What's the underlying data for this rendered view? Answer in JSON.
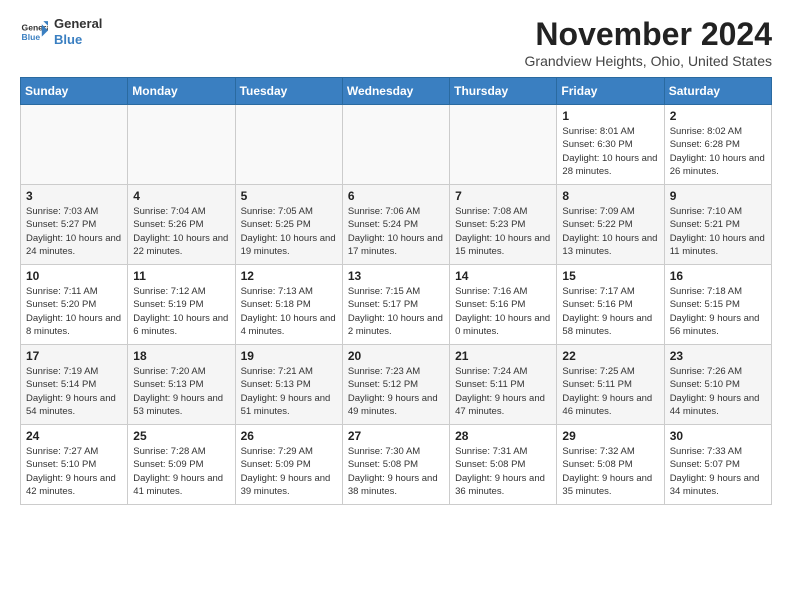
{
  "header": {
    "logo_line1": "General",
    "logo_line2": "Blue",
    "month": "November 2024",
    "location": "Grandview Heights, Ohio, United States"
  },
  "days_of_week": [
    "Sunday",
    "Monday",
    "Tuesday",
    "Wednesday",
    "Thursday",
    "Friday",
    "Saturday"
  ],
  "weeks": [
    [
      {
        "day": "",
        "info": ""
      },
      {
        "day": "",
        "info": ""
      },
      {
        "day": "",
        "info": ""
      },
      {
        "day": "",
        "info": ""
      },
      {
        "day": "",
        "info": ""
      },
      {
        "day": "1",
        "info": "Sunrise: 8:01 AM\nSunset: 6:30 PM\nDaylight: 10 hours and 28 minutes."
      },
      {
        "day": "2",
        "info": "Sunrise: 8:02 AM\nSunset: 6:28 PM\nDaylight: 10 hours and 26 minutes."
      }
    ],
    [
      {
        "day": "3",
        "info": "Sunrise: 7:03 AM\nSunset: 5:27 PM\nDaylight: 10 hours and 24 minutes."
      },
      {
        "day": "4",
        "info": "Sunrise: 7:04 AM\nSunset: 5:26 PM\nDaylight: 10 hours and 22 minutes."
      },
      {
        "day": "5",
        "info": "Sunrise: 7:05 AM\nSunset: 5:25 PM\nDaylight: 10 hours and 19 minutes."
      },
      {
        "day": "6",
        "info": "Sunrise: 7:06 AM\nSunset: 5:24 PM\nDaylight: 10 hours and 17 minutes."
      },
      {
        "day": "7",
        "info": "Sunrise: 7:08 AM\nSunset: 5:23 PM\nDaylight: 10 hours and 15 minutes."
      },
      {
        "day": "8",
        "info": "Sunrise: 7:09 AM\nSunset: 5:22 PM\nDaylight: 10 hours and 13 minutes."
      },
      {
        "day": "9",
        "info": "Sunrise: 7:10 AM\nSunset: 5:21 PM\nDaylight: 10 hours and 11 minutes."
      }
    ],
    [
      {
        "day": "10",
        "info": "Sunrise: 7:11 AM\nSunset: 5:20 PM\nDaylight: 10 hours and 8 minutes."
      },
      {
        "day": "11",
        "info": "Sunrise: 7:12 AM\nSunset: 5:19 PM\nDaylight: 10 hours and 6 minutes."
      },
      {
        "day": "12",
        "info": "Sunrise: 7:13 AM\nSunset: 5:18 PM\nDaylight: 10 hours and 4 minutes."
      },
      {
        "day": "13",
        "info": "Sunrise: 7:15 AM\nSunset: 5:17 PM\nDaylight: 10 hours and 2 minutes."
      },
      {
        "day": "14",
        "info": "Sunrise: 7:16 AM\nSunset: 5:16 PM\nDaylight: 10 hours and 0 minutes."
      },
      {
        "day": "15",
        "info": "Sunrise: 7:17 AM\nSunset: 5:16 PM\nDaylight: 9 hours and 58 minutes."
      },
      {
        "day": "16",
        "info": "Sunrise: 7:18 AM\nSunset: 5:15 PM\nDaylight: 9 hours and 56 minutes."
      }
    ],
    [
      {
        "day": "17",
        "info": "Sunrise: 7:19 AM\nSunset: 5:14 PM\nDaylight: 9 hours and 54 minutes."
      },
      {
        "day": "18",
        "info": "Sunrise: 7:20 AM\nSunset: 5:13 PM\nDaylight: 9 hours and 53 minutes."
      },
      {
        "day": "19",
        "info": "Sunrise: 7:21 AM\nSunset: 5:13 PM\nDaylight: 9 hours and 51 minutes."
      },
      {
        "day": "20",
        "info": "Sunrise: 7:23 AM\nSunset: 5:12 PM\nDaylight: 9 hours and 49 minutes."
      },
      {
        "day": "21",
        "info": "Sunrise: 7:24 AM\nSunset: 5:11 PM\nDaylight: 9 hours and 47 minutes."
      },
      {
        "day": "22",
        "info": "Sunrise: 7:25 AM\nSunset: 5:11 PM\nDaylight: 9 hours and 46 minutes."
      },
      {
        "day": "23",
        "info": "Sunrise: 7:26 AM\nSunset: 5:10 PM\nDaylight: 9 hours and 44 minutes."
      }
    ],
    [
      {
        "day": "24",
        "info": "Sunrise: 7:27 AM\nSunset: 5:10 PM\nDaylight: 9 hours and 42 minutes."
      },
      {
        "day": "25",
        "info": "Sunrise: 7:28 AM\nSunset: 5:09 PM\nDaylight: 9 hours and 41 minutes."
      },
      {
        "day": "26",
        "info": "Sunrise: 7:29 AM\nSunset: 5:09 PM\nDaylight: 9 hours and 39 minutes."
      },
      {
        "day": "27",
        "info": "Sunrise: 7:30 AM\nSunset: 5:08 PM\nDaylight: 9 hours and 38 minutes."
      },
      {
        "day": "28",
        "info": "Sunrise: 7:31 AM\nSunset: 5:08 PM\nDaylight: 9 hours and 36 minutes."
      },
      {
        "day": "29",
        "info": "Sunrise: 7:32 AM\nSunset: 5:08 PM\nDaylight: 9 hours and 35 minutes."
      },
      {
        "day": "30",
        "info": "Sunrise: 7:33 AM\nSunset: 5:07 PM\nDaylight: 9 hours and 34 minutes."
      }
    ]
  ]
}
